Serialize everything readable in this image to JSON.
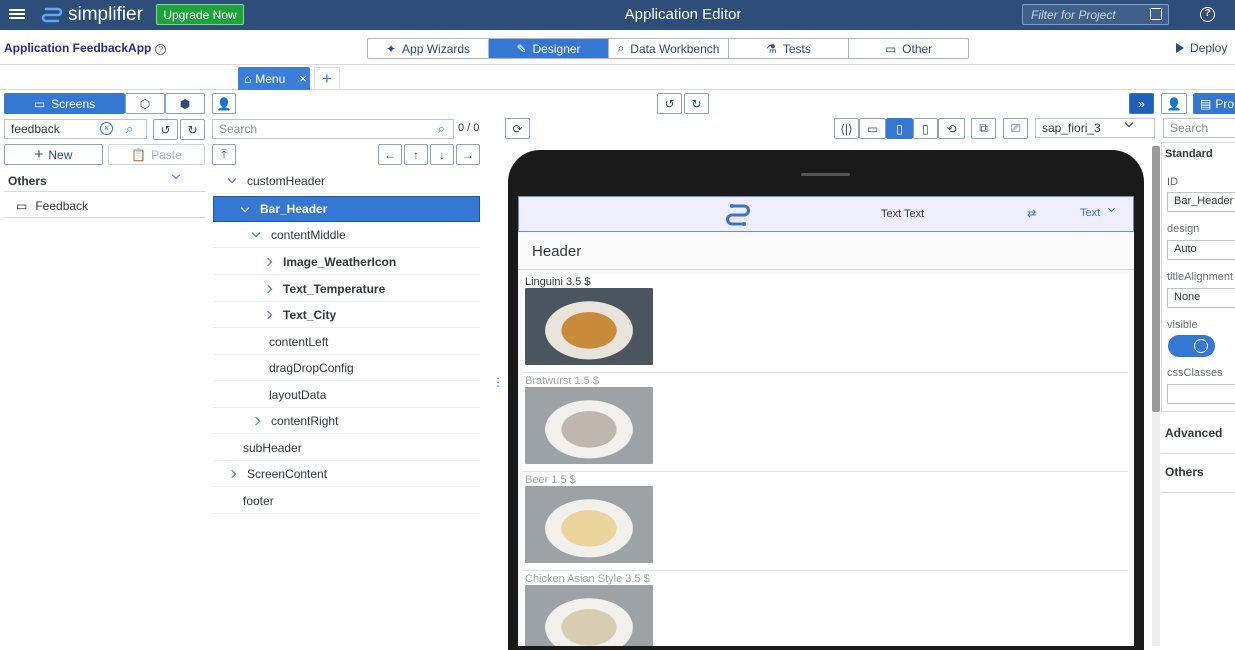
{
  "topbar": {
    "brand": "simplifier",
    "upgrade": "Upgrade Now",
    "title": "Application Editor",
    "filter_placeholder": "Filter for Project",
    "help": "?"
  },
  "app": {
    "name": "Application FeedbackApp",
    "deploy": "Deploy"
  },
  "nav": {
    "tabs": [
      "App Wizards",
      "Designer",
      "Data Workbench",
      "Tests",
      "Other"
    ],
    "selected": "Designer"
  },
  "editor_tab": {
    "label": "Menu",
    "close": "×",
    "add": "+"
  },
  "left": {
    "screens_label": "Screens",
    "search_value": "feedback",
    "new_label": "New",
    "paste_label": "Paste",
    "group": "Others",
    "items": [
      "Feedback"
    ]
  },
  "tree": {
    "search_placeholder": "Search",
    "count": "0 / 0",
    "rows": [
      {
        "label": "customHeader",
        "chev": "d"
      },
      {
        "label": "Bar_Header",
        "chev": "d",
        "selected": true
      },
      {
        "label": "contentMiddle",
        "chev": "d"
      },
      {
        "label": "Image_WeatherIcon",
        "chev": "r",
        "bold": true
      },
      {
        "label": "Text_Temperature",
        "chev": "r",
        "bold": true
      },
      {
        "label": "Text_City",
        "chev": "r",
        "bold": true
      },
      {
        "label": "contentLeft"
      },
      {
        "label": "dragDropConfig"
      },
      {
        "label": "layoutData"
      },
      {
        "label": "contentRight",
        "chev": "r"
      },
      {
        "label": "subHeader"
      },
      {
        "label": "ScreenContent",
        "chev": "r"
      },
      {
        "label": "footer"
      }
    ]
  },
  "preview": {
    "theme": "sap_fiori_3",
    "bar_text": "Text  Text",
    "bar_right": "Text",
    "page_header": "Header",
    "foods": [
      {
        "label": "Linguini 3.5 $",
        "color": "#c98a3a"
      },
      {
        "label": "Bratwurst 1.5 $",
        "color": "#8b7a6e"
      },
      {
        "label": "Beer 1.5 $",
        "color": "#d8b04a"
      },
      {
        "label": "Chicken Asian Style 3.5 $",
        "color": "#b9a374"
      }
    ]
  },
  "props": {
    "search_placeholder": "Search",
    "props_btn": "Pro",
    "standard": "Standard",
    "id_label": "ID",
    "id_value": "Bar_Header",
    "design_label": "design",
    "design_value": "Auto",
    "title_label": "titleAlignment",
    "title_value": "None",
    "visible_label": "visible",
    "css_label": "cssClasses",
    "advanced": "Advanced",
    "others": "Others"
  }
}
